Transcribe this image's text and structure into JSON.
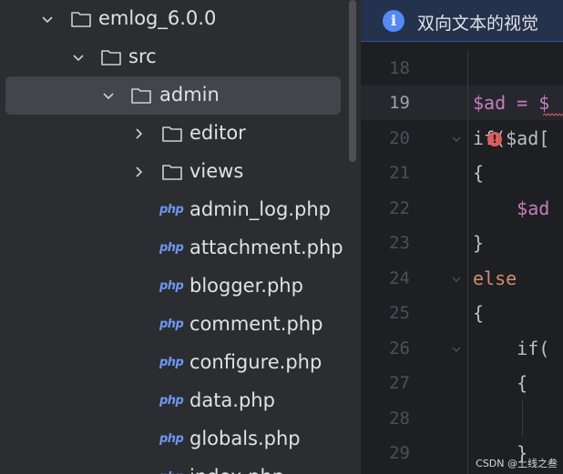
{
  "tree": {
    "items": [
      {
        "label": "emlog_6.0.0",
        "type": "folder",
        "expanded": true
      },
      {
        "label": "src",
        "type": "folder",
        "expanded": true
      },
      {
        "label": "admin",
        "type": "folder",
        "expanded": true,
        "selected": true
      },
      {
        "label": "editor",
        "type": "folder",
        "expanded": false
      },
      {
        "label": "views",
        "type": "folder",
        "expanded": false
      },
      {
        "label": "admin_log.php",
        "type": "php"
      },
      {
        "label": "attachment.php",
        "type": "php"
      },
      {
        "label": "blogger.php",
        "type": "php"
      },
      {
        "label": "comment.php",
        "type": "php"
      },
      {
        "label": "configure.php",
        "type": "php"
      },
      {
        "label": "data.php",
        "type": "php"
      },
      {
        "label": "globals.php",
        "type": "php"
      },
      {
        "label": "index.php",
        "type": "php"
      }
    ],
    "php_icon_text": "php"
  },
  "editor": {
    "banner": {
      "icon": "info-icon",
      "text": "双向文本的视觉"
    },
    "line_numbers": [
      "18",
      "19",
      "20",
      "21",
      "22",
      "23",
      "24",
      "25",
      "26",
      "27",
      "28",
      "29"
    ],
    "active_line": "19",
    "code_lines": [
      {
        "text": ""
      },
      {
        "text": "$ad = $"
      },
      {
        "text": "if($ad["
      },
      {
        "text": "{"
      },
      {
        "text": "    $ad"
      },
      {
        "text": "}"
      },
      {
        "text": "else"
      },
      {
        "text": "{"
      },
      {
        "text": "    if("
      },
      {
        "text": "    {"
      },
      {
        "text": ""
      },
      {
        "text": "    }"
      }
    ]
  },
  "watermark": "CSDN @上线之叁",
  "colors": {
    "accent": "#548af7",
    "php_icon": "#6b97f5",
    "variable": "#c77dbb",
    "keyword": "#cf8e6d",
    "error": "#db5c5c"
  }
}
